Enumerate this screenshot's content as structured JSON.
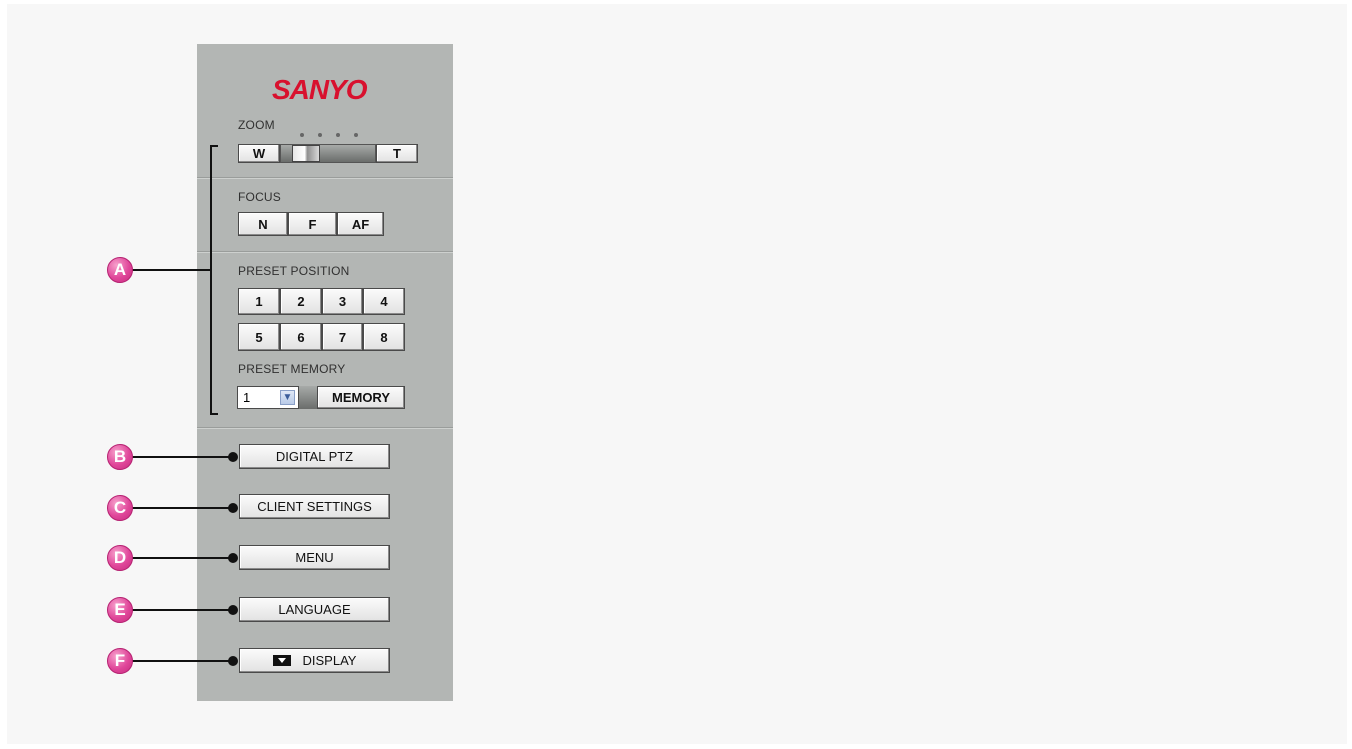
{
  "brand": {
    "logo_text": "SANYO",
    "logo_color": "#d8112e"
  },
  "zoom": {
    "label": "ZOOM",
    "wide_label": "W",
    "tele_label": "T"
  },
  "focus": {
    "label": "FOCUS",
    "near_label": "N",
    "far_label": "F",
    "auto_label": "AF"
  },
  "preset_position": {
    "label": "PRESET POSITION",
    "buttons": [
      "1",
      "2",
      "3",
      "4",
      "5",
      "6",
      "7",
      "8"
    ]
  },
  "preset_memory": {
    "label": "PRESET MEMORY",
    "selected_value": "1",
    "button_label": "MEMORY"
  },
  "menu_buttons": {
    "digital_ptz": "DIGITAL PTZ",
    "client_settings": "CLIENT SETTINGS",
    "menu": "MENU",
    "language": "LANGUAGE",
    "display": "DISPLAY"
  },
  "callouts": [
    "A",
    "B",
    "C",
    "D",
    "E",
    "F"
  ],
  "colors": {
    "callout": "#e0479a",
    "panel": "#b3b6b4",
    "background": "#f7f7f7"
  }
}
